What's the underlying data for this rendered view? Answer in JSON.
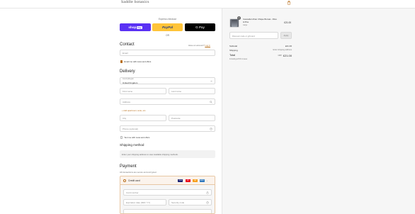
{
  "header": {
    "brand": "Saddle botanics",
    "cart_icon": "shopping-bag-icon"
  },
  "express": {
    "label": "Express checkout",
    "shoppay_label": "shop",
    "shoppay_badge": "Pay",
    "paypal_label": "PayPal",
    "gpay_label": "G Pay",
    "or_label": "OR"
  },
  "contact": {
    "title": "Contact",
    "have_account_text": "Have an account?",
    "login_link": "Log in",
    "email_placeholder": "Email",
    "news_label": "Email me with news and offers"
  },
  "delivery": {
    "title": "Delivery",
    "country_label": "Country/Region",
    "country_value": "United Kingdom",
    "first_name_placeholder": "First name",
    "last_name_placeholder": "Last name",
    "address_placeholder": "Address",
    "address_hint": "+ Add apartment, suite, etc.",
    "city_placeholder": "City",
    "postcode_placeholder": "Postcode",
    "phone_placeholder": "Phone (optional)",
    "save_info_label": "Text me with news and offers"
  },
  "shipping": {
    "title": "Shipping method",
    "message": "Enter your shipping address to view available shipping methods."
  },
  "payment": {
    "title": "Payment",
    "subtitle": "All transactions are secure and encrypted.",
    "method_label": "Credit card",
    "card_number_placeholder": "Card number",
    "expiry_placeholder": "Expiration date (MM / YY)",
    "security_placeholder": "Security code",
    "card_logos": [
      {
        "name": "VISA",
        "color": "#1a1f71"
      },
      {
        "name": "MC",
        "color": "#eb001b"
      },
      {
        "name": "MA",
        "color": "#f79e1b"
      },
      {
        "name": "AMEX",
        "color": "#2e77bc"
      }
    ]
  },
  "summary": {
    "item": {
      "name": "Cascadia Urban Chique Bonsai - Olive & Pine",
      "variant": "Large",
      "price": "£21.00",
      "quantity": "1"
    },
    "discount_placeholder": "Discount code or gift card",
    "apply_label": "Apply",
    "subtotal_label": "Subtotal",
    "subtotal_value": "£21.00",
    "shipping_label": "Shipping",
    "shipping_value": "Enter shipping address",
    "total_label": "Total",
    "total_currency": "GBP",
    "total_value": "£21.00",
    "tax_note": "Including £3.50 in taxes"
  },
  "colors": {
    "accent": "#b86e1a",
    "shoppay": "#5a31f4",
    "paypal": "#ffc439"
  }
}
